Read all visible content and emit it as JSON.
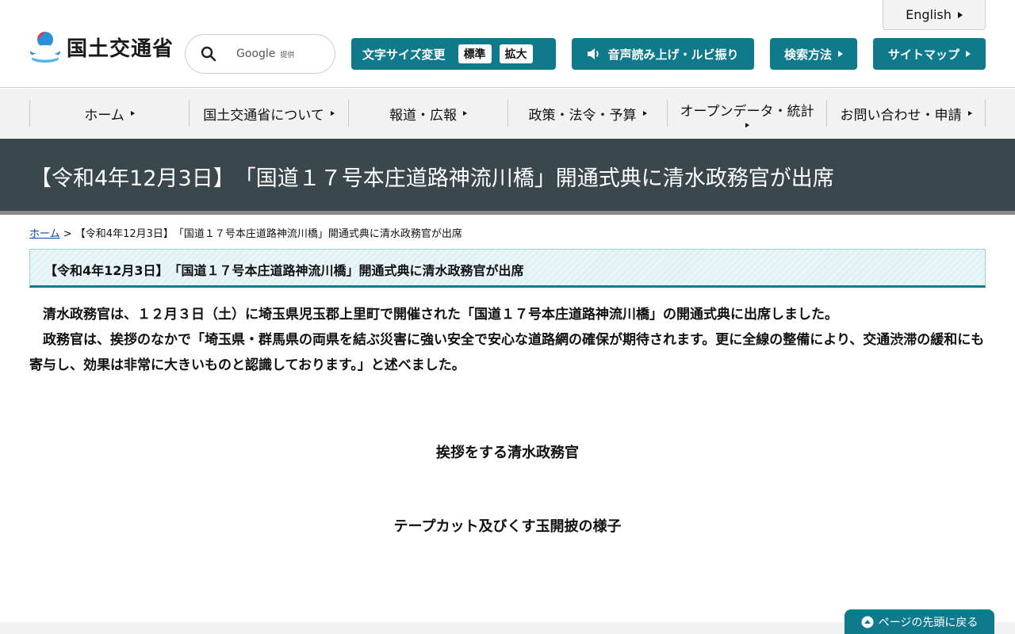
{
  "header": {
    "logo_text": "国土交通省",
    "search": {
      "google": "Google",
      "provided": "提供"
    },
    "language_button": "English",
    "font_size": {
      "label": "文字サイズ変更",
      "standard": "標準",
      "enlarge": "拡大"
    },
    "speech_button": "音声読み上げ・ルビ振り",
    "search_method_button": "検索方法",
    "sitemap_button": "サイトマップ"
  },
  "nav": {
    "items": [
      "ホーム",
      "国土交通省について",
      "報道・広報",
      "政策・法令・予算",
      "オープンデータ・統計",
      "お問い合わせ・申請"
    ]
  },
  "page": {
    "title": "【令和4年12月3日】　「国道１７号本庄道路神流川橋」開通式典に清水政務官が出席",
    "breadcrumb_home": "ホーム",
    "breadcrumb_sep": " > ",
    "breadcrumb_current": "【令和4年12月3日】　「国道１７号本庄道路神流川橋」開通式典に清水政務官が出席",
    "heading": "【令和4年12月3日】　「国道１７号本庄道路神流川橋」開通式典に清水政務官が出席",
    "paragraph1": "　清水政務官は、１２月３日（土）に埼玉県児玉郡上里町で開催された「国道１７号本庄道路神流川橋」の開通式典に出席しました。",
    "paragraph2": "　政務官は、挨拶のなかで「埼玉県・群馬県の両県を結ぶ災害に強い安全で安心な道路網の確保が期待されます。更に全線の整備により、交通渋滞の緩和にも寄与し、効果は非常に大きいものと認識しております。」と述べました。",
    "caption1": "挨拶をする清水政務官",
    "caption2": "テープカット及びくす玉開披の様子"
  },
  "back_to_top": "ページの先頭に戻る",
  "colors": {
    "accent": "#0e7a8c",
    "banner": "#3a474d"
  }
}
